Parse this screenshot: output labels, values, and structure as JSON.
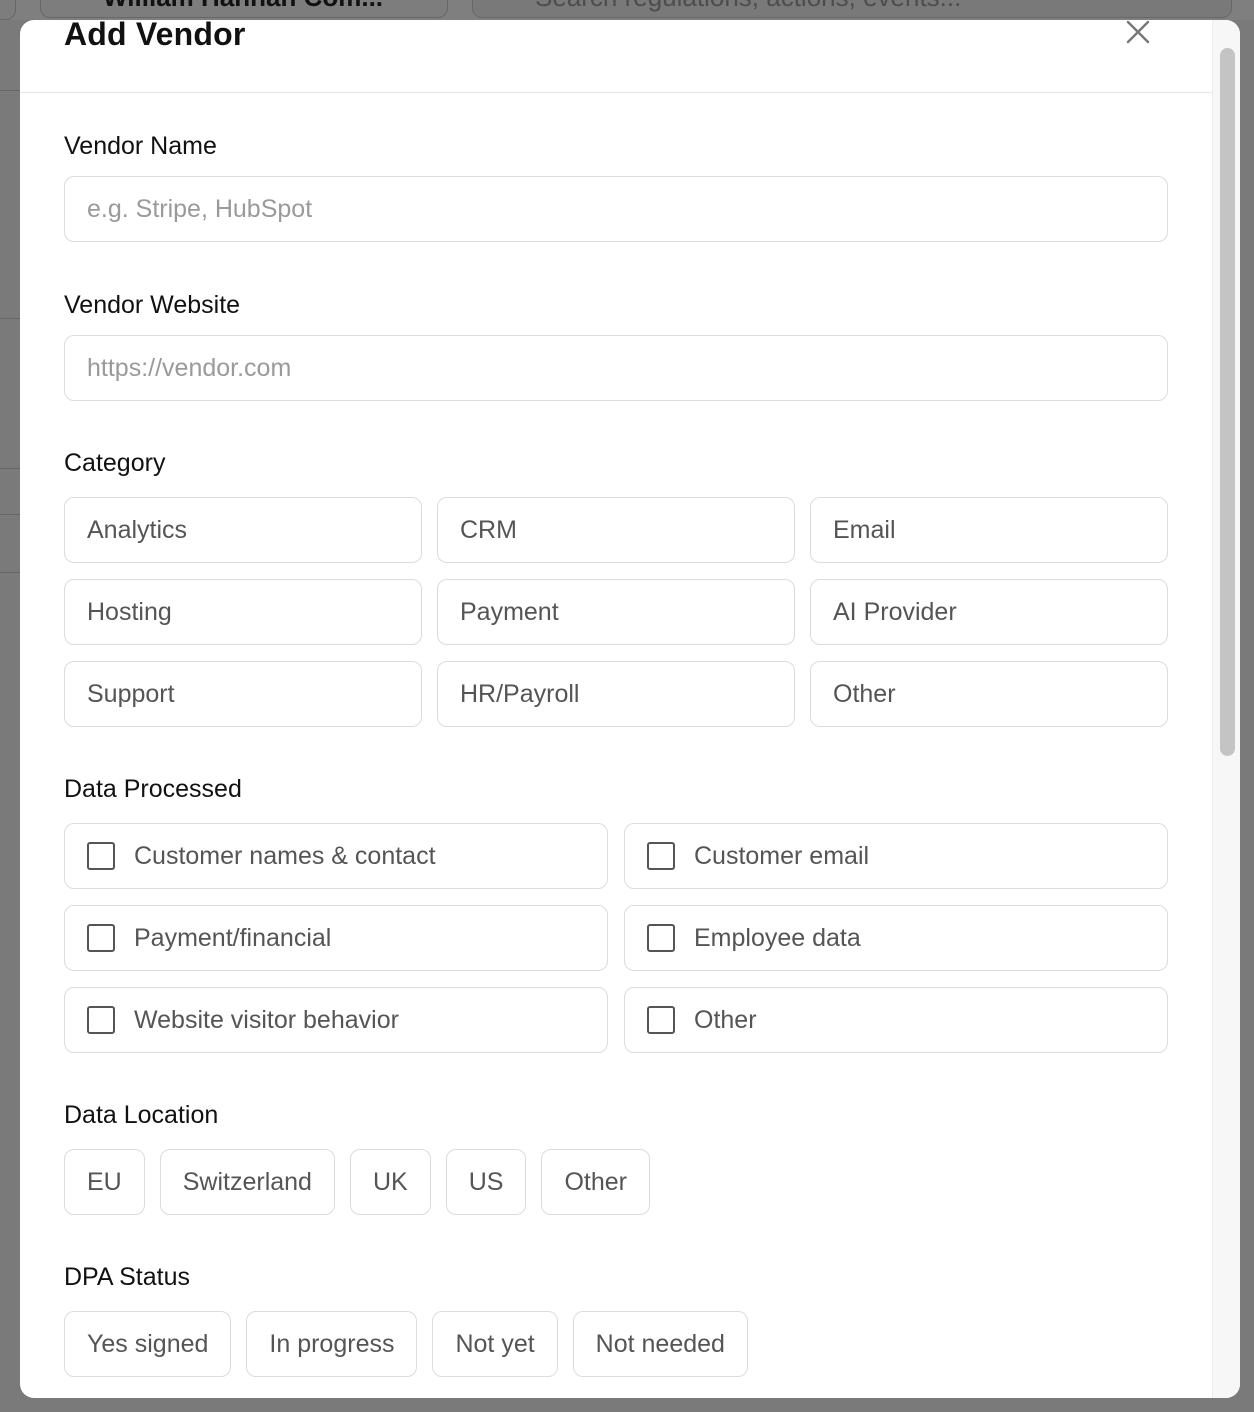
{
  "background": {
    "workspace_tab": "William Hannan Com...",
    "search_placeholder": "Search regulations, actions, events..."
  },
  "modal": {
    "title": "Add Vendor",
    "close_label": "×"
  },
  "form": {
    "vendor_name": {
      "label": "Vendor Name",
      "placeholder": "e.g. Stripe, HubSpot",
      "value": ""
    },
    "vendor_website": {
      "label": "Vendor Website",
      "placeholder": "https://vendor.com",
      "value": ""
    },
    "category": {
      "label": "Category",
      "options": [
        "Analytics",
        "CRM",
        "Email",
        "Hosting",
        "Payment",
        "AI Provider",
        "Support",
        "HR/Payroll",
        "Other"
      ]
    },
    "data_processed": {
      "label": "Data Processed",
      "options": [
        {
          "label": "Customer names & contact",
          "checked": false
        },
        {
          "label": "Customer email",
          "checked": false
        },
        {
          "label": "Payment/financial",
          "checked": false
        },
        {
          "label": "Employee data",
          "checked": false
        },
        {
          "label": "Website visitor behavior",
          "checked": false
        },
        {
          "label": "Other",
          "checked": false
        }
      ]
    },
    "data_location": {
      "label": "Data Location",
      "options": [
        "EU",
        "Switzerland",
        "UK",
        "US",
        "Other"
      ]
    },
    "dpa_status": {
      "label": "DPA Status",
      "options": [
        "Yes signed",
        "In progress",
        "Not yet",
        "Not needed"
      ]
    }
  },
  "colors": {
    "border": "#dcdcdc",
    "option_text": "#555555",
    "title_text": "#111111",
    "overlay": "#7d7d7d"
  }
}
